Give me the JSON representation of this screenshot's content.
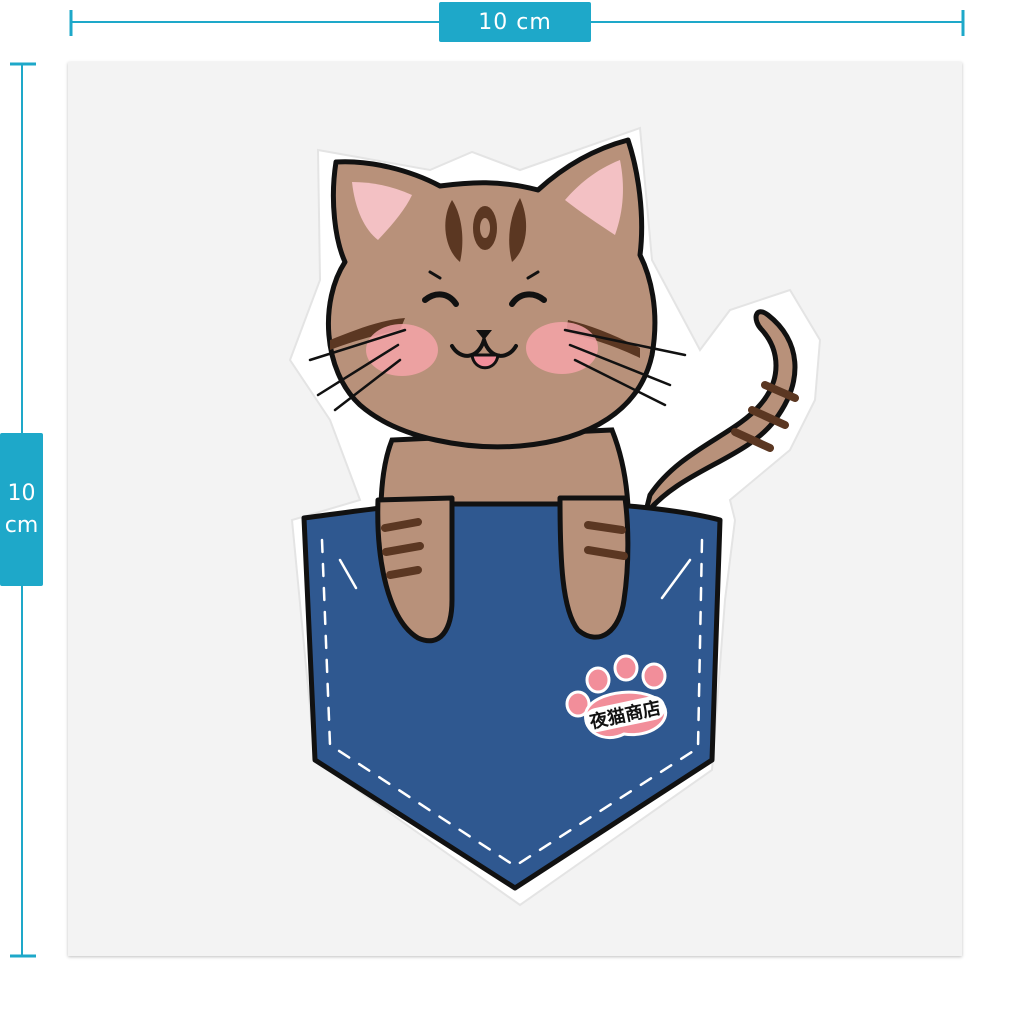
{
  "dimensions": {
    "width_label": "10 cm",
    "height_value": "10",
    "height_unit": "cm"
  },
  "sticker": {
    "shop_stamp_text": "夜猫商店",
    "colors": {
      "accent": "#1ea8c9",
      "cat_fur": "#b8917a",
      "cat_stripe": "#5b3722",
      "pocket": "#2f5890",
      "blush": "#f4a3a8",
      "ear_inner": "#f3c1c4",
      "paw_pad": "#f28e9a"
    }
  }
}
